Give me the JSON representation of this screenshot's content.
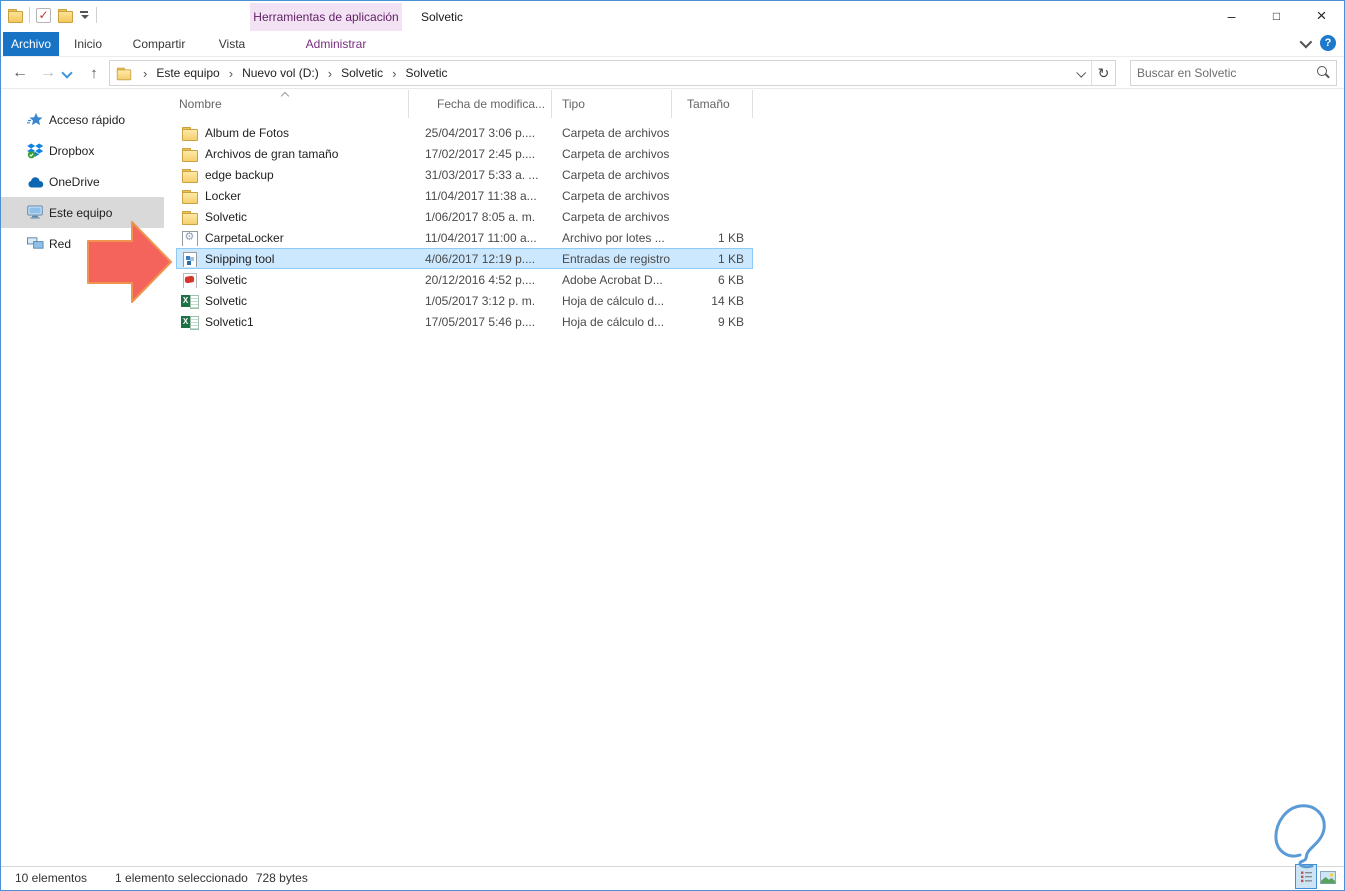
{
  "window": {
    "title": "Solvetic",
    "controls": {
      "minimize": "–",
      "maximize": "□",
      "close": "×"
    }
  },
  "ribbon": {
    "contextual_header": "Herramientas de aplicación",
    "tabs": [
      {
        "label": "Archivo",
        "active": true
      },
      {
        "label": "Inicio"
      },
      {
        "label": "Compartir"
      },
      {
        "label": "Vista"
      },
      {
        "label": "Administrar",
        "contextual": true
      }
    ],
    "help_label": "?"
  },
  "toolbar": {
    "breadcrumb": [
      "Este equipo",
      "Nuevo vol (D:)",
      "Solvetic",
      "Solvetic"
    ],
    "breadcrumb_separator": "›",
    "refresh_icon": "↻",
    "back_icon": "←",
    "forward_icon": "→",
    "up_icon": "↑",
    "search_placeholder": "Buscar en Solvetic"
  },
  "sidebar": {
    "items": [
      {
        "label": "Acceso rápido",
        "icon": "quick-access-star"
      },
      {
        "label": "Dropbox",
        "icon": "dropbox"
      },
      {
        "label": "OneDrive",
        "icon": "onedrive-cloud"
      },
      {
        "label": "Este equipo",
        "icon": "this-pc-monitor",
        "selected": true
      },
      {
        "label": "Red",
        "icon": "network"
      }
    ]
  },
  "filelist": {
    "columns": [
      "Nombre",
      "Fecha de modifica...",
      "Tipo",
      "Tamaño"
    ],
    "rows": [
      {
        "name": "Album de Fotos",
        "modified": "25/04/2017 3:06 p....",
        "type": "Carpeta de archivos",
        "size": "",
        "icon": "folder"
      },
      {
        "name": "Archivos de gran tamaño",
        "modified": "17/02/2017 2:45 p....",
        "type": "Carpeta de archivos",
        "size": "",
        "icon": "folder"
      },
      {
        "name": "edge backup",
        "modified": "31/03/2017 5:33 a. ...",
        "type": "Carpeta de archivos",
        "size": "",
        "icon": "folder"
      },
      {
        "name": "Locker",
        "modified": "11/04/2017 11:38 a...",
        "type": "Carpeta de archivos",
        "size": "",
        "icon": "folder"
      },
      {
        "name": "Solvetic",
        "modified": "1/06/2017 8:05 a. m.",
        "type": "Carpeta de archivos",
        "size": "",
        "icon": "folder"
      },
      {
        "name": "CarpetaLocker",
        "modified": "11/04/2017 11:00 a...",
        "type": "Archivo por lotes ...",
        "size": "1 KB",
        "icon": "batch-file"
      },
      {
        "name": "Snipping tool",
        "modified": "4/06/2017 12:19 p....",
        "type": "Entradas de registro",
        "size": "1 KB",
        "icon": "registry-file",
        "selected": true
      },
      {
        "name": "Solvetic",
        "modified": "20/12/2016 4:52 p....",
        "type": "Adobe Acrobat D...",
        "size": "6 KB",
        "icon": "pdf-file"
      },
      {
        "name": "Solvetic",
        "modified": "1/05/2017 3:12 p. m.",
        "type": "Hoja de cálculo d...",
        "size": "14 KB",
        "icon": "excel-file"
      },
      {
        "name": "Solvetic1",
        "modified": "17/05/2017 5:46 p....",
        "type": "Hoja de cálculo d...",
        "size": "9 KB",
        "icon": "excel-file"
      }
    ]
  },
  "statusbar": {
    "items_count": "10 elementos",
    "selection": "1 elemento seleccionado",
    "selection_size": "728 bytes"
  },
  "colors": {
    "accent_blue": "#1873c5",
    "contextual_pink_bg": "#f3e2f4",
    "contextual_purple_text": "#7a2e7f",
    "selection_bg": "#cce8ff",
    "selection_border": "#8ecaf7",
    "sidebar_selected_bg": "#d9d9d9",
    "annotation_arrow_fill": "#f4645c",
    "annotation_arrow_stroke": "#f0934f",
    "window_border": "#4a90d7"
  }
}
